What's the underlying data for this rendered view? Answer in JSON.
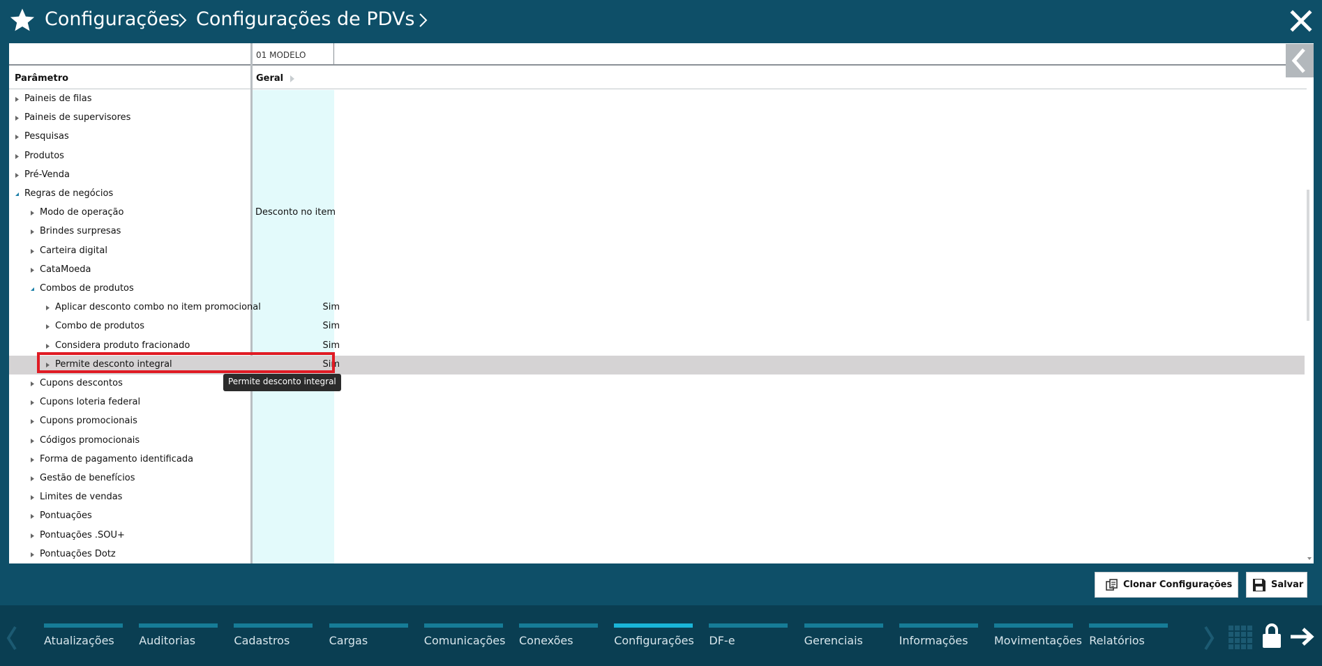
{
  "header": {
    "breadcrumb": [
      "Configurações",
      "Configurações de PDVs"
    ]
  },
  "grid": {
    "column_group": "01 MODELO",
    "param_header": "Parâmetro",
    "value_header": "Geral",
    "rows": [
      {
        "label": "Paineis de filas",
        "level": 0,
        "expanded": false,
        "value": ""
      },
      {
        "label": "Paineis de supervisores",
        "level": 0,
        "expanded": false,
        "value": ""
      },
      {
        "label": "Pesquisas",
        "level": 0,
        "expanded": false,
        "value": ""
      },
      {
        "label": "Produtos",
        "level": 0,
        "expanded": false,
        "value": ""
      },
      {
        "label": "Pré-Venda",
        "level": 0,
        "expanded": false,
        "value": ""
      },
      {
        "label": "Regras de negócios",
        "level": 0,
        "expanded": true,
        "value": ""
      },
      {
        "label": "Modo de operação",
        "level": 1,
        "expanded": false,
        "value": "Desconto no item"
      },
      {
        "label": "Brindes surpresas",
        "level": 1,
        "expanded": false,
        "value": ""
      },
      {
        "label": "Carteira digital",
        "level": 1,
        "expanded": false,
        "value": ""
      },
      {
        "label": "CataMoeda",
        "level": 1,
        "expanded": false,
        "value": ""
      },
      {
        "label": "Combos de produtos",
        "level": 1,
        "expanded": true,
        "value": ""
      },
      {
        "label": "Aplicar desconto combo no item promocional",
        "level": 2,
        "expanded": false,
        "value": "Sim"
      },
      {
        "label": "Combo de produtos",
        "level": 2,
        "expanded": false,
        "value": "Sim"
      },
      {
        "label": "Considera produto fracionado",
        "level": 2,
        "expanded": false,
        "value": "Sim"
      },
      {
        "label": "Permite desconto integral",
        "level": 2,
        "expanded": false,
        "value": "Sim",
        "selected": true
      },
      {
        "label": "Cupons descontos",
        "level": 1,
        "expanded": false,
        "value": ""
      },
      {
        "label": "Cupons loteria federal",
        "level": 1,
        "expanded": false,
        "value": ""
      },
      {
        "label": "Cupons promocionais",
        "level": 1,
        "expanded": false,
        "value": ""
      },
      {
        "label": "Códigos promocionais",
        "level": 1,
        "expanded": false,
        "value": ""
      },
      {
        "label": "Forma de pagamento identificada",
        "level": 1,
        "expanded": false,
        "value": ""
      },
      {
        "label": "Gestão de benefícios",
        "level": 1,
        "expanded": false,
        "value": ""
      },
      {
        "label": "Limites de vendas",
        "level": 1,
        "expanded": false,
        "value": ""
      },
      {
        "label": "Pontuações",
        "level": 1,
        "expanded": false,
        "value": ""
      },
      {
        "label": "Pontuações .SOU+",
        "level": 1,
        "expanded": false,
        "value": ""
      },
      {
        "label": "Pontuações Dotz",
        "level": 1,
        "expanded": false,
        "value": ""
      }
    ],
    "tooltip": "Permite desconto integral"
  },
  "actions": {
    "clone_label": "Clonar Configurações",
    "save_label": "Salvar"
  },
  "nav": {
    "items": [
      {
        "label": "Atualizações",
        "active": false
      },
      {
        "label": "Auditorias",
        "active": false
      },
      {
        "label": "Cadastros",
        "active": false
      },
      {
        "label": "Cargas",
        "active": false
      },
      {
        "label": "Comunicações",
        "active": false
      },
      {
        "label": "Conexões",
        "active": false
      },
      {
        "label": "Configurações",
        "active": true
      },
      {
        "label": "DF-e",
        "active": false
      },
      {
        "label": "Gerenciais",
        "active": false
      },
      {
        "label": "Informações",
        "active": false
      },
      {
        "label": "Movimentações",
        "active": false
      },
      {
        "label": "Relatórios",
        "active": false
      }
    ]
  },
  "colors": {
    "background": "#0e4f68",
    "footer": "#0a3e52",
    "value_column": "#e3fafb",
    "selected_row": "#d5d3d4",
    "highlight": "#e01b24",
    "nav_active": "#1ab5d8"
  }
}
